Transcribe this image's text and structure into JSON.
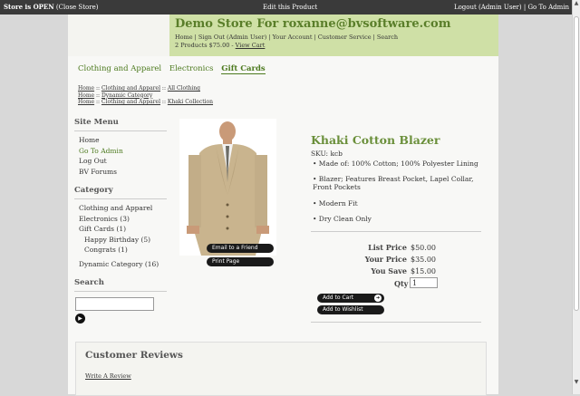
{
  "topbar": {
    "store_status": "Store is OPEN",
    "close_store": "(Close Store)",
    "edit_product": "Edit this Product",
    "logout": "Logout (Admin User)",
    "separator": "|",
    "go_to_admin": "Go To Admin"
  },
  "header": {
    "store_title": "Demo Store For roxanne@bvsoftware.com",
    "links": "Home | Sign Out (Admin User) | Your Account | Customer Service | Search",
    "cart_summary": "2 Products $75.00 - ",
    "view_cart": "View Cart"
  },
  "category_tabs": [
    {
      "label": "Clothing and Apparel"
    },
    {
      "label": "Electronics"
    },
    {
      "label": "Gift Cards"
    }
  ],
  "breadcrumbs": [
    {
      "home": "Home",
      "sep": " :: ",
      "parent": "Clothing and Apparel",
      "sep2": " :: ",
      "child": "All Clothing"
    },
    {
      "home": "Home",
      "sep": " :: ",
      "parent": "Dynamic Category"
    },
    {
      "home": "Home",
      "sep": " :: ",
      "parent": "Clothing and Apparel",
      "sep2": " :: ",
      "child": "Khaki Collection"
    }
  ],
  "site_menu": {
    "title": "Site Menu",
    "items": [
      "Home",
      "Go To Admin",
      "Log Out",
      "BV Forums"
    ]
  },
  "category": {
    "title": "Category",
    "items": [
      "Clothing and Apparel",
      "Electronics (3)",
      "Gift Cards (1)",
      "Happy Birthday (5)",
      "Congrats (1)",
      "Dynamic Category (16)"
    ]
  },
  "search": {
    "title": "Search",
    "value": ""
  },
  "product": {
    "title": "Khaki Cotton Blazer",
    "sku": "SKU: kcb",
    "features": [
      "• Made of: 100% Cotton; 100% Polyester Lining",
      "• Blazer; Features Breast Pocket, Lapel Collar, Front Pockets",
      "• Modern Fit",
      "• Dry Clean Only"
    ],
    "email_friend": "Email to a Friend",
    "print_page": "Print Page",
    "list_price_label": "List Price",
    "list_price": "$50.00",
    "your_price_label": "Your Price",
    "your_price": "$35.00",
    "you_save_label": "You Save",
    "you_save": "$15.00",
    "qty_label": "Qty",
    "qty": "1",
    "add_to_cart": "Add to Cart",
    "add_to_wishlist": "Add to Wishlist"
  },
  "reviews": {
    "title": "Customer Reviews",
    "write_review": "Write A Review"
  },
  "colors": {
    "accent_green": "#6a8f3a",
    "header_bg": "#cfe0a6",
    "topbar_bg": "#3a3a3a"
  }
}
